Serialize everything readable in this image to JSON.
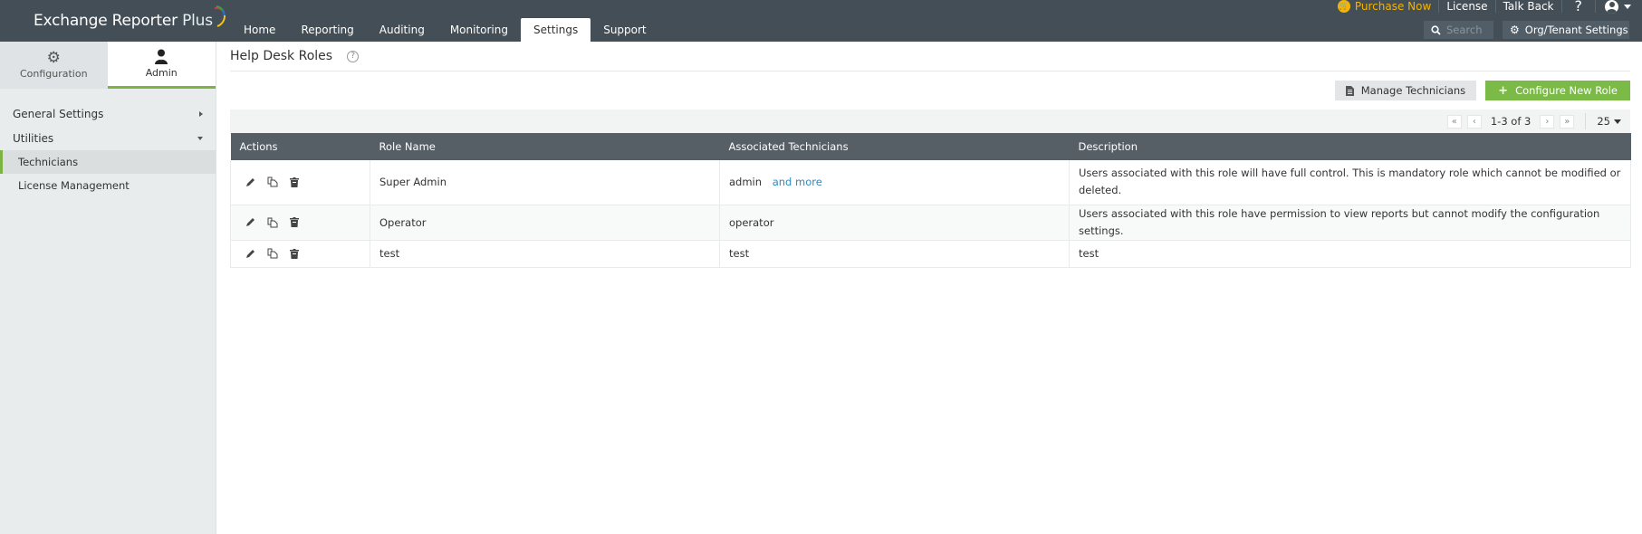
{
  "app": {
    "title_main": "Exchange Reporter",
    "title_plus": "Plus"
  },
  "nav": {
    "tabs": [
      {
        "label": "Home"
      },
      {
        "label": "Reporting"
      },
      {
        "label": "Auditing"
      },
      {
        "label": "Monitoring"
      },
      {
        "label": "Settings",
        "active": true
      },
      {
        "label": "Support"
      }
    ]
  },
  "topbar": {
    "purchase": "Purchase Now",
    "license": "License",
    "talkback": "Talk Back",
    "help": "?",
    "search_placeholder": "Search",
    "org_settings": "Org/Tenant Settings"
  },
  "sidebar": {
    "tabs": [
      {
        "label": "Configuration",
        "icon": "gear-icon"
      },
      {
        "label": "Admin",
        "icon": "user-icon",
        "active": true
      }
    ],
    "groups": [
      {
        "label": "General Settings",
        "expanded": false
      },
      {
        "label": "Utilities",
        "expanded": true
      }
    ],
    "items": [
      {
        "label": "Technicians",
        "active": true
      },
      {
        "label": "License Management"
      }
    ]
  },
  "page": {
    "title": "Help Desk Roles",
    "help": "?",
    "manage_btn": "Manage Technicians",
    "config_btn": "Configure New Role"
  },
  "pager": {
    "range": "1-3 of 3",
    "page_size": "25"
  },
  "table": {
    "headers": [
      "Actions",
      "Role Name",
      "Associated Technicians",
      "Description"
    ],
    "rows": [
      {
        "role": "Super Admin",
        "tech": "admin",
        "more": "and more",
        "desc": "Users associated with this role will have full control. This is mandatory role which cannot be modified or deleted."
      },
      {
        "role": "Operator",
        "tech": "operator",
        "more": null,
        "desc": "Users associated with this role have permission to view reports but cannot modify the configuration settings."
      },
      {
        "role": "test",
        "tech": "test",
        "more": null,
        "desc": "test"
      }
    ]
  },
  "colors": {
    "topbar": "#434e56",
    "accent_green": "#7cba48",
    "purchase_yellow": "#f4b400",
    "link_blue": "#2d8bc2",
    "table_header": "#565f66"
  }
}
